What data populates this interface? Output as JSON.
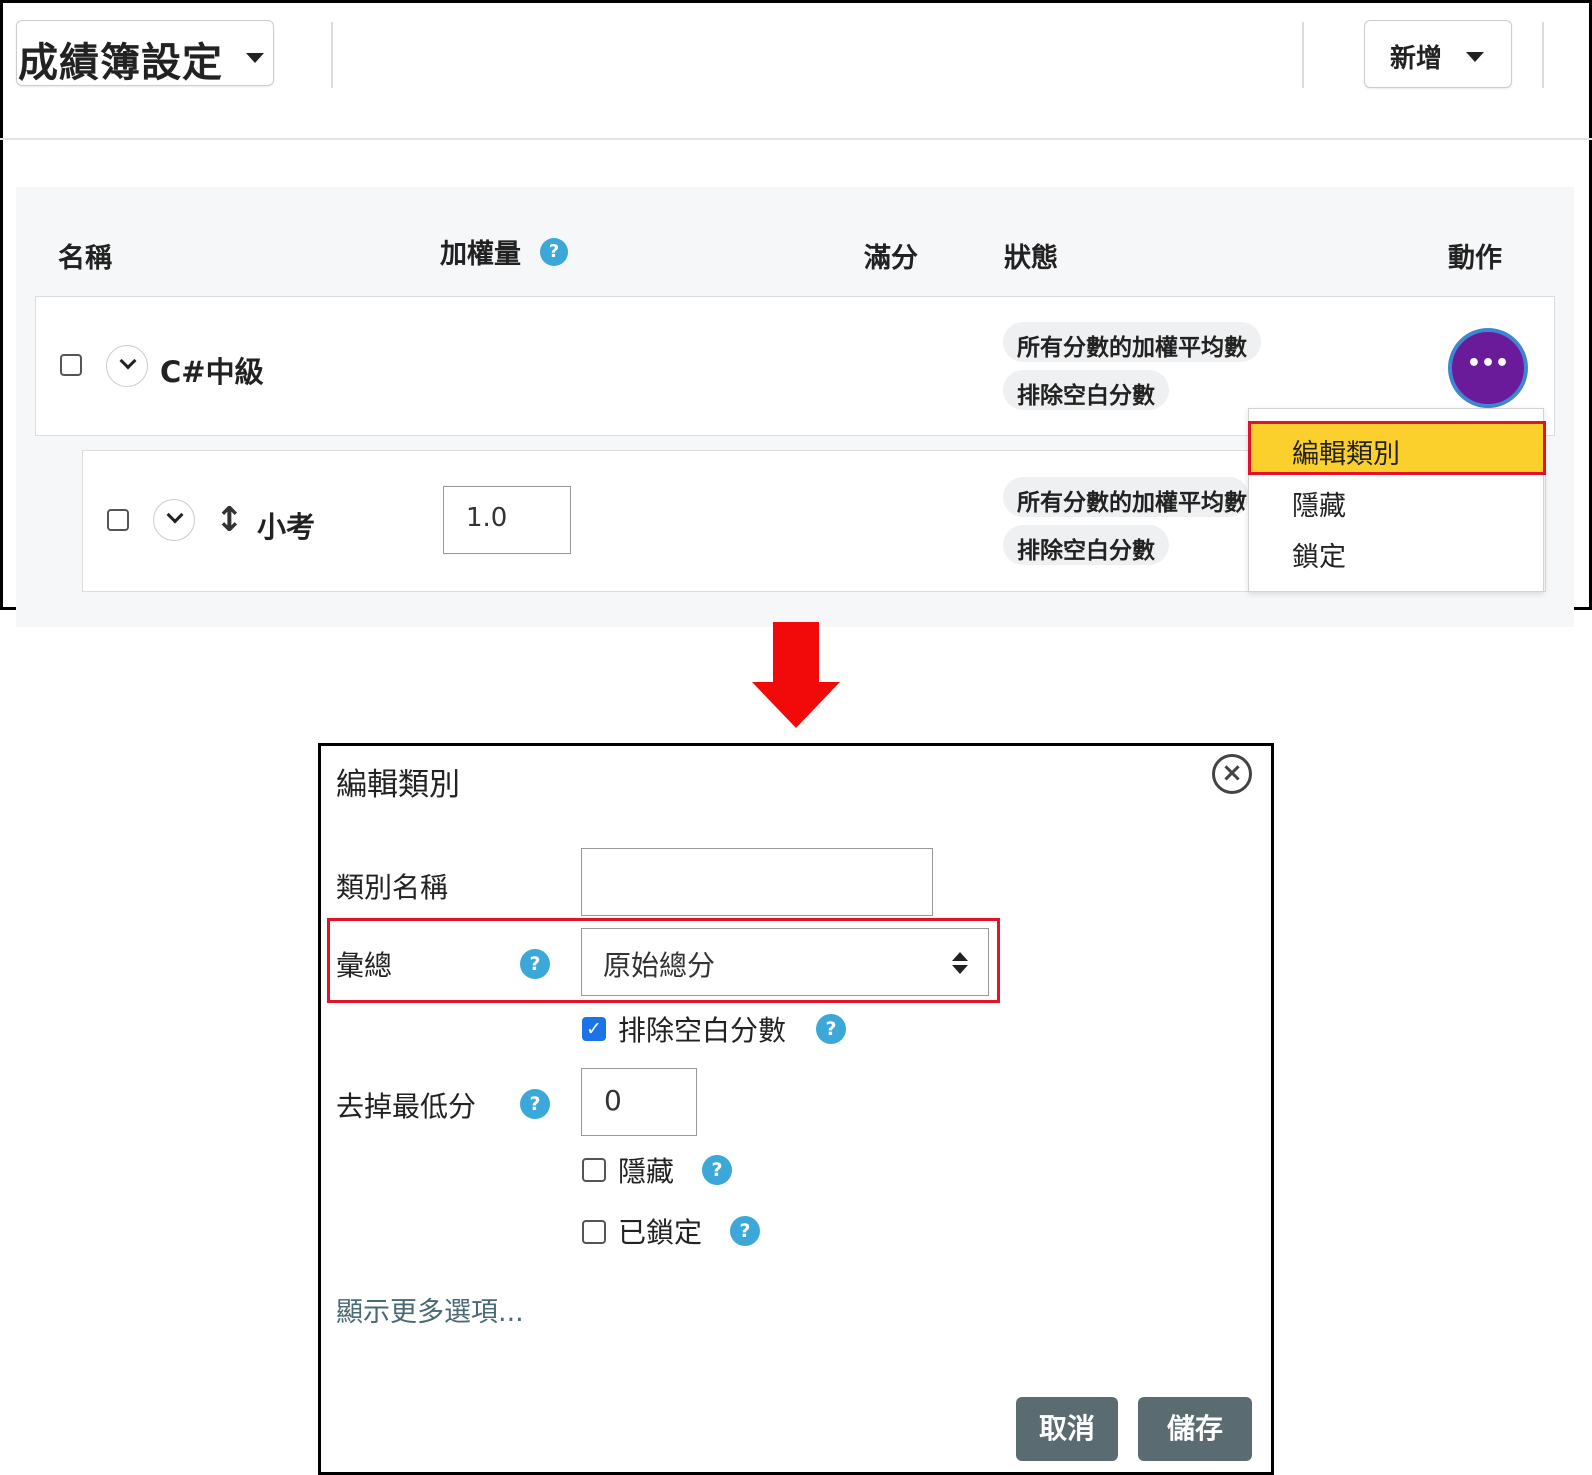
{
  "top": {
    "gradebook_title": "成績簿設定",
    "add_button": "新增",
    "headers": {
      "name": "名稱",
      "weight": "加權量",
      "max": "滿分",
      "status": "狀態",
      "actions": "動作"
    },
    "rows": [
      {
        "name": "C#中級",
        "status": [
          "所有分數的加權平均數",
          "排除空白分數"
        ]
      },
      {
        "name": "小考",
        "weight": "1.0",
        "status": [
          "所有分數的加權平均數",
          "排除空白分數"
        ]
      }
    ],
    "action_button": "•••",
    "menu": [
      "編輯類別",
      "隱藏",
      "鎖定"
    ]
  },
  "modal": {
    "title": "編輯類別",
    "close_icon": "⊗",
    "fields": {
      "category_name_label": "類別名稱",
      "category_name_value": "",
      "aggregation_label": "彙總",
      "aggregation_value": "原始總分",
      "exclude_empty_label": "排除空白分數",
      "exclude_empty_checked": true,
      "drop_lowest_label": "去掉最低分",
      "drop_lowest_value": "0",
      "hidden_label": "隱藏",
      "hidden_checked": false,
      "locked_label": "已鎖定",
      "locked_checked": false
    },
    "more_options": "顯示更多選項...",
    "cancel": "取消",
    "save": "儲存"
  },
  "icons": {
    "help": "?",
    "move": "↕",
    "check": "✓"
  },
  "colors": {
    "accent": "#6a1b9a",
    "highlight": "#fbd02d",
    "highlight_border": "#e3122a",
    "arrow": "#f20a0a",
    "help": "#3ca7d9",
    "button": "#5a6b72"
  }
}
